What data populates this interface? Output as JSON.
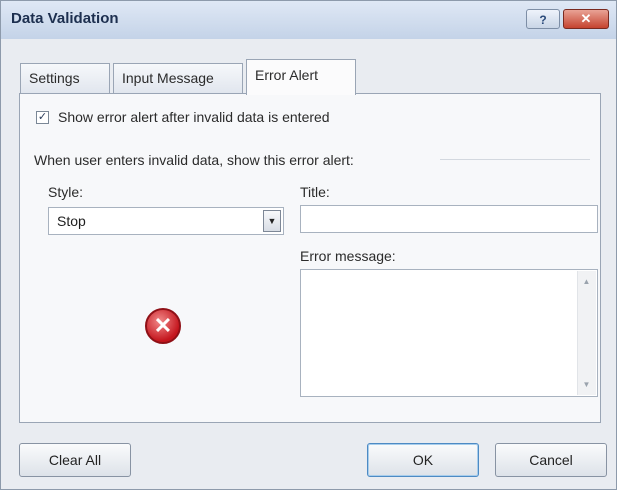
{
  "window": {
    "title": "Data Validation",
    "help_label": "?",
    "close_label": "✕"
  },
  "tabs": [
    {
      "label": "Settings",
      "active": false
    },
    {
      "label": "Input Message",
      "active": false
    },
    {
      "label": "Error Alert",
      "active": true
    }
  ],
  "error_alert": {
    "show_alert_checked": true,
    "show_alert_label": "Show error alert after invalid data is entered",
    "group_label": "When user enters invalid data, show this error alert:",
    "style_label": "Style:",
    "style_value": "Stop",
    "title_label": "Title:",
    "title_value": "",
    "message_label": "Error message:",
    "message_value": "",
    "icon": "error-stop-icon"
  },
  "buttons": {
    "clear_all": "Clear All",
    "ok": "OK",
    "cancel": "Cancel"
  }
}
